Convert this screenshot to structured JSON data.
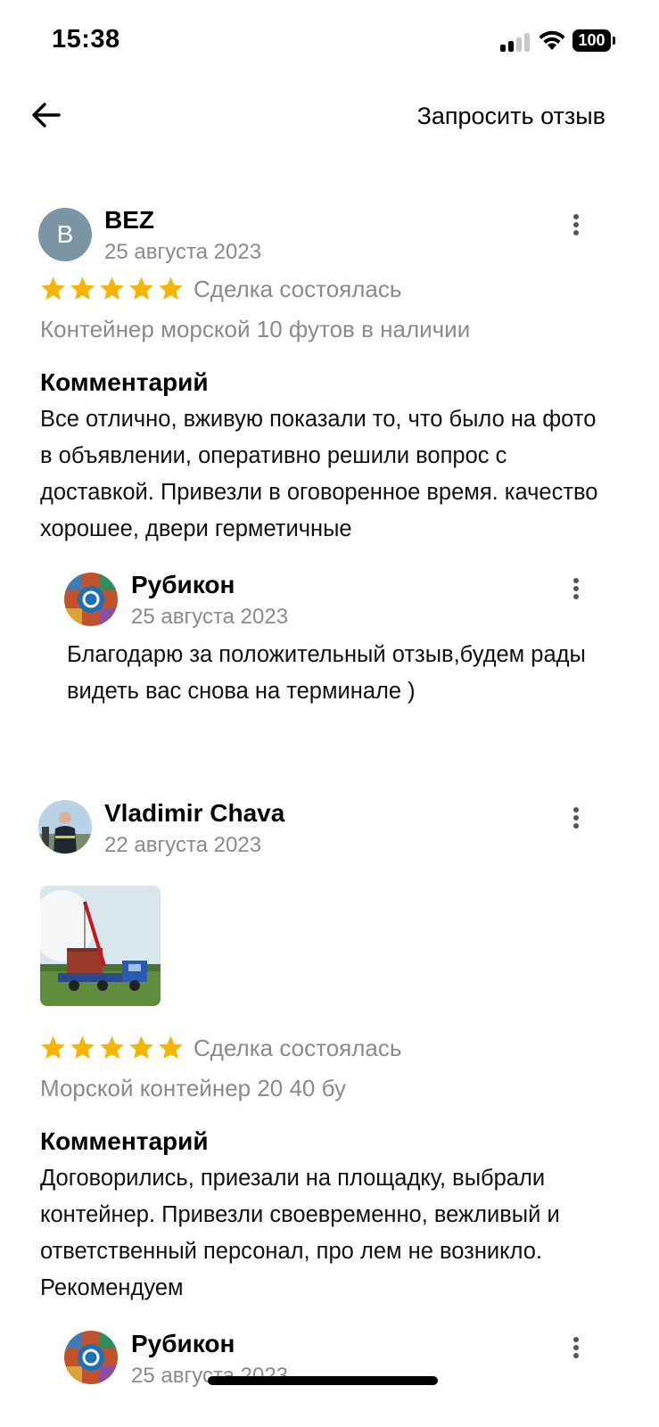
{
  "status_bar": {
    "time": "15:38",
    "battery": "100"
  },
  "header": {
    "action_label": "Запросить отзыв"
  },
  "reviews": [
    {
      "avatar_letter": "B",
      "author": "BEZ",
      "date": "25 августа 2023",
      "rating": 5,
      "deal_status": "Сделка состоялась",
      "item": "Контейнер морской 10 футов в наличии",
      "comment_heading": "Комментарий",
      "comment": "Все отлично, вживую показали то, что было на фото в объявлении, оперативно решили вопрос с доставкой. Привезли в оговоренное время. качество хорошее, двери герметичные",
      "reply": {
        "author": "Рубикон",
        "date": "25 августа 2023",
        "text": "Благодарю за положительный отзыв,будем рады видеть вас снова на терминале )"
      }
    },
    {
      "author": "Vladimir Chava",
      "date": "22 августа 2023",
      "rating": 5,
      "deal_status": "Сделка состоялась",
      "item": "Морской контейнер 20 40 бу",
      "comment_heading": "Комментарий",
      "comment": "Договорились, приезали на площадку, выбрали контейнер. Привезли своевременно, вежливый и ответственный персонал, про лем не возникло. Рекомендуем",
      "reply": {
        "author": "Рубикон",
        "date": "25 августа 2023"
      }
    }
  ],
  "colors": {
    "star": "#f6b500",
    "secondary_text": "#8a8a8a",
    "avatar_bg": "#7b95a5"
  }
}
